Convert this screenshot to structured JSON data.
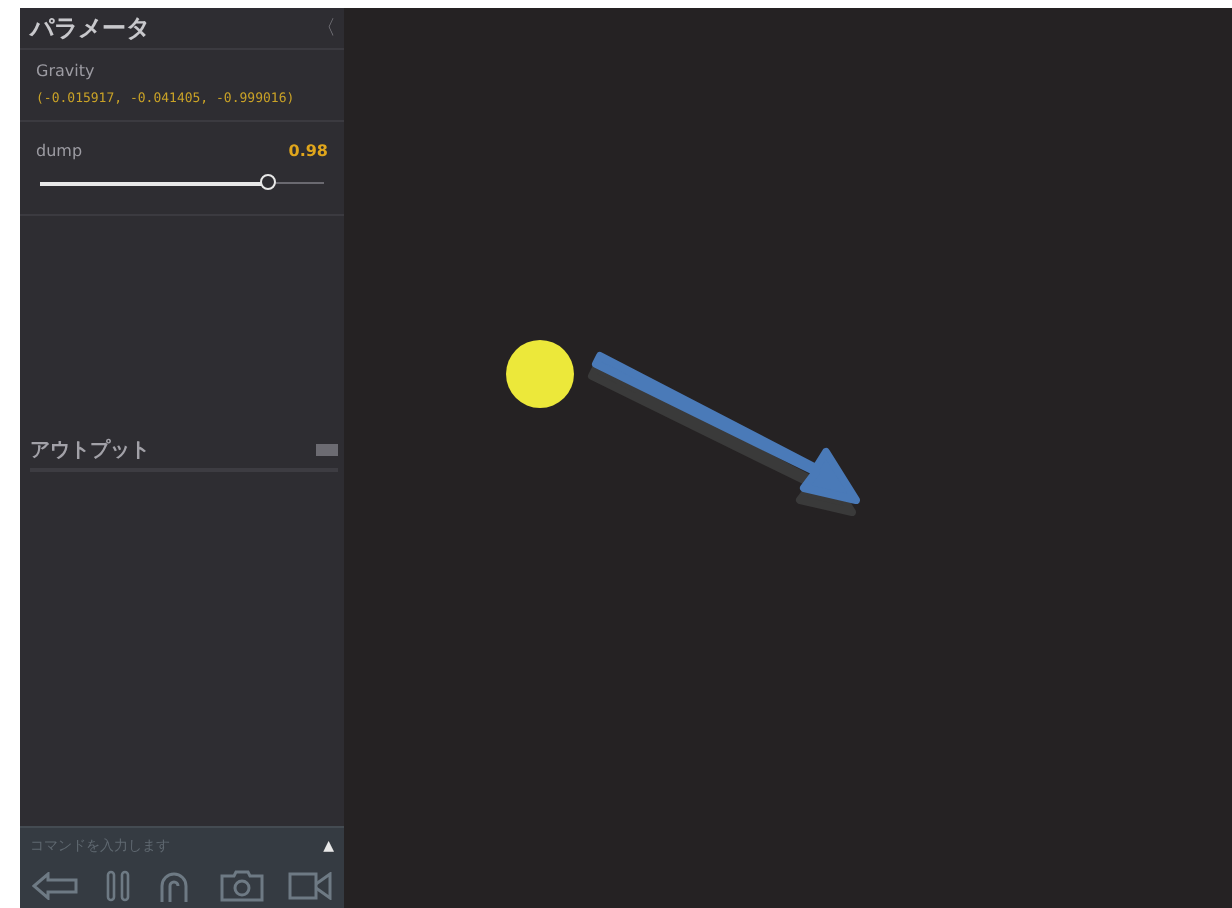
{
  "sidebar": {
    "title": "パラメータ",
    "collapse_glyph": "〈",
    "parameters": [
      {
        "kind": "vector",
        "label": "Gravity",
        "value": "(-0.015917, -0.041405, -0.999016)"
      },
      {
        "kind": "slider",
        "label": "dump",
        "value": "0.98",
        "level": 0.8
      }
    ],
    "output": {
      "title": "アウトプット"
    },
    "command": {
      "placeholder": "コマンドを入力します",
      "toggle_glyph": "▲"
    }
  }
}
